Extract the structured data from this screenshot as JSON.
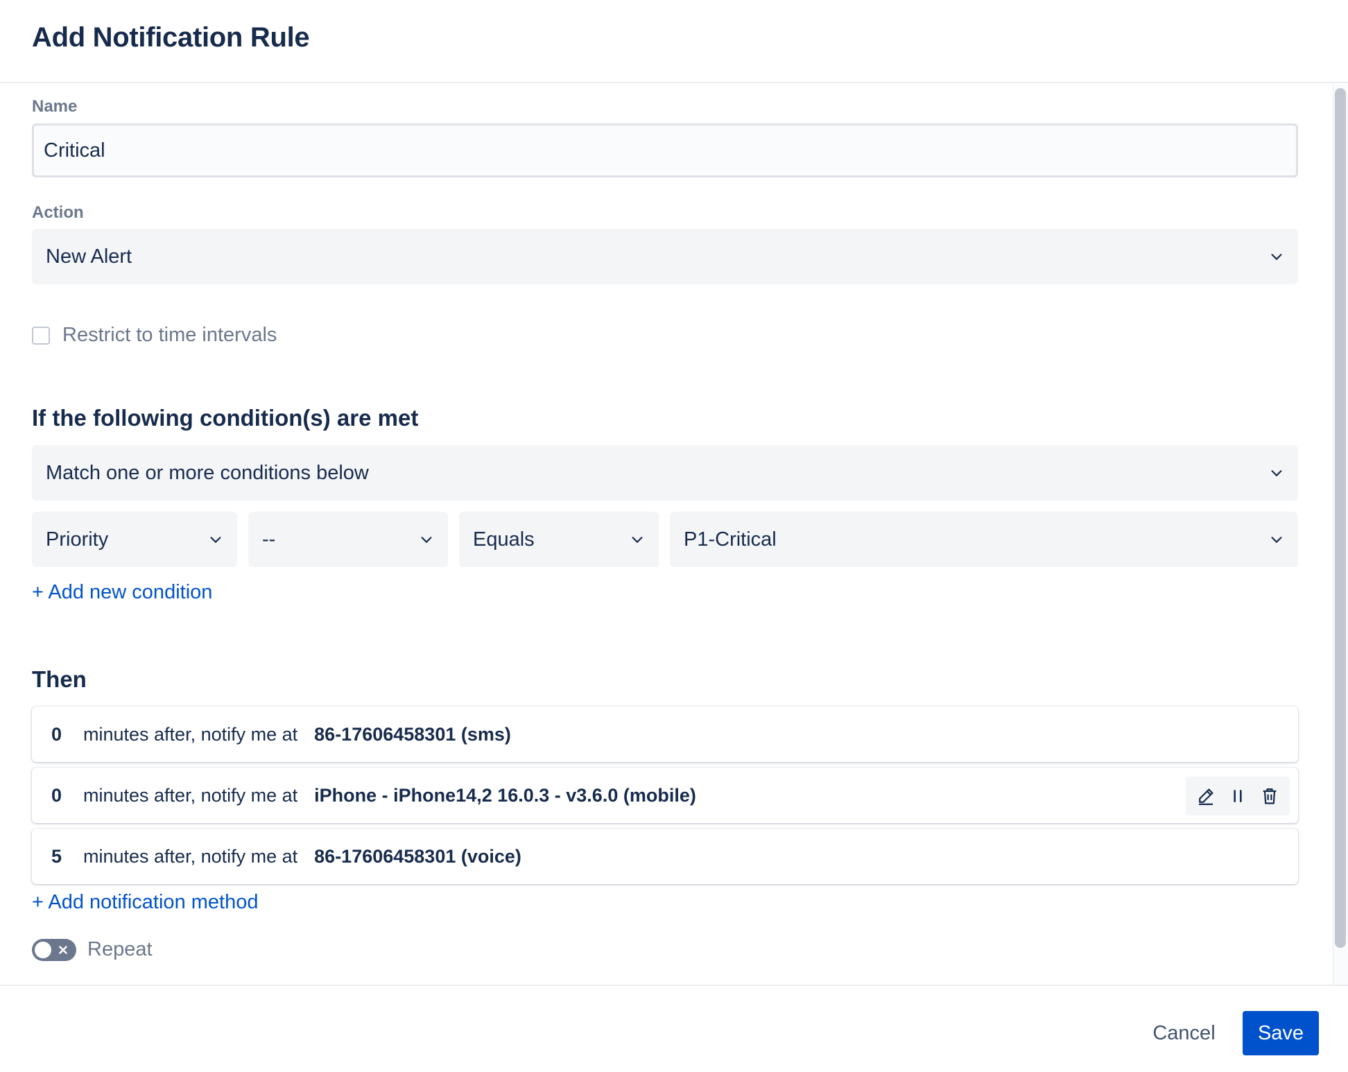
{
  "dialog": {
    "title": "Add Notification Rule"
  },
  "form": {
    "name_label": "Name",
    "name_value": "Critical",
    "action_label": "Action",
    "action_value": "New Alert",
    "restrict_label": "Restrict to time intervals",
    "restrict_checked": false
  },
  "conditions": {
    "title": "If the following condition(s) are met",
    "match_value": "Match one or more conditions below",
    "rule": {
      "field": "Priority",
      "not_value": "--",
      "operator": "Equals",
      "value": "P1-Critical"
    },
    "add_condition_label": "+ Add new condition"
  },
  "then": {
    "title": "Then",
    "rows": [
      {
        "minutes": "0",
        "text": "minutes after, notify me at",
        "target": "86-17606458301 (sms)"
      },
      {
        "minutes": "0",
        "text": "minutes after, notify me at",
        "target": "iPhone - iPhone14,2 16.0.3 - v3.6.0 (mobile)"
      },
      {
        "minutes": "5",
        "text": "minutes after, notify me at",
        "target": "86-17606458301 (voice)"
      }
    ],
    "add_method_label": "+ Add notification method",
    "repeat_label": "Repeat",
    "repeat_on": false
  },
  "footer": {
    "cancel_label": "Cancel",
    "save_label": "Save"
  },
  "colors": {
    "primary": "#0052cc",
    "text": "#172b4d",
    "muted": "#6b778c",
    "field_bg": "#f4f5f7"
  }
}
